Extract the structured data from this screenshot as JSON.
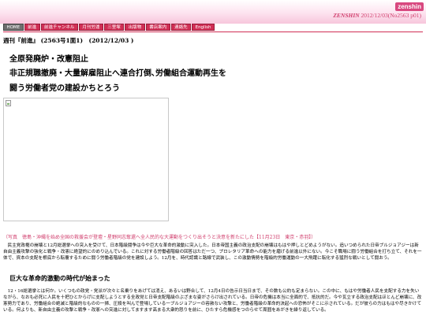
{
  "header": {
    "brand": "zenshin",
    "site_name": "ZENSHIN",
    "site_meta": "2012/12/03(No2563 p01)"
  },
  "nav": {
    "items": [
      {
        "label": "HOME",
        "active": true
      },
      {
        "label": "前進",
        "active": false
      },
      {
        "label": "前進チャンネル",
        "active": false
      },
      {
        "label": "月刊労運",
        "active": false
      },
      {
        "label": "三里塚",
        "active": false
      },
      {
        "label": "出版物",
        "active": false
      },
      {
        "label": "書店案内",
        "active": false
      },
      {
        "label": "連絡先",
        "active": false
      },
      {
        "label": "English",
        "active": false
      }
    ]
  },
  "article": {
    "issue_line": "週刊『前進』 (2563号1面1)　(2012/12/03 )",
    "headlines": [
      "全原発廃炉・改憲阻止",
      "非正規職撤廃・大量解雇阻止へ連合打倒､労働組合運動再生を",
      "闘う労働者党の建設かちとろう"
    ],
    "photo_caption": "（写真　徳島・沖縄を始め全国の救援会が登壇・星野同志奪還へ全人民的な大運動をつくり出そうと決意を新たにした【11月23日　東京・赤羽】）",
    "paragraph1": "民主党政権の崩壊と12月総選挙への突入を受けて、日本階級闘争は今や巨大な革命的激動に突入した。日本帝国主義の政治支配の崩壊はもはや押しとどめようがない。追いつめられた日帝ブルジョアジーは新自由主義攻撃の強化と戦争・改憲に絶望的にのめり込んでいる。これに対する労働者階級の回答はただ一つ、プロレタリア革命への能力を磨げる前進以外にない。今こそ職場に闘う労働組合を打ち立て、それを一体で、資本の支配を根底から転覆するために闘う労働者階級の党を建設しよう。12月を、時代認識と路線で武装し、この激動情勢を階級的労働運動の一大飛躍に転化する猛烈な戦いとして闘おう。",
    "subheading": "巨大な革命的激動の時代が始まった",
    "paragraph2": "12・16総選挙とは何か。いくつもの政党・党派が次々と名乗りをあげては消え、あるいは野合して、12月4日の告示日当日まで、その数も公約も定まらない。この中に、もはや労働者人民を支配する力を失いながら、なおも必死に人民を十把ひとからげに支配しようとする全政党と日帝支配階級のぶざまな姿がさらけ出されている。日帝の危機は本当に全面的で、抵抗的だ。今や瓦立する政治支配はほとんど崩壊に、改憲勢力であり、労働組合の絶滅と階級的なものの一掃、圧殺を叫んで登場している一ブルジョアジーの容赦ない攻撃と、労働者階級の革命的決起への恐怖がそこに示されている。だが彼らの力はもはや尽きかけている。何よりも、新自由主義の攻撃と戦争・改憲への突進に対してますます高まる大衆的怒りを前に、ひたすら危機感をつのらせて周囲をあがきを繰り返している。"
  }
}
